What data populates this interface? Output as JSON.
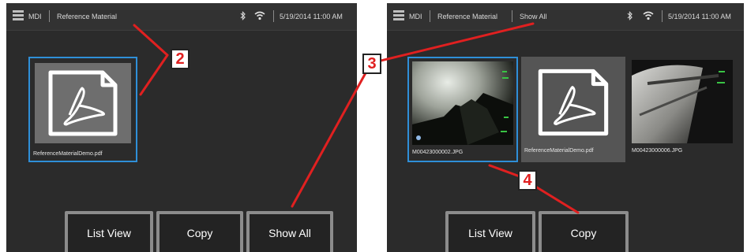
{
  "left_screen": {
    "topbar": {
      "app_label": "MDI",
      "folder_label": "Reference Material",
      "datetime": "5/19/2014 11:00 AM"
    },
    "files": [
      {
        "name": "ReferenceMaterialDemo.pdf",
        "selected": true
      }
    ],
    "buttons": {
      "list_view": "List View",
      "copy": "Copy",
      "show_all": "Show All"
    }
  },
  "right_screen": {
    "topbar": {
      "app_label": "MDI",
      "folder_label": "Reference Material",
      "view_label": "Show All",
      "datetime": "5/19/2014 11:00 AM"
    },
    "files": [
      {
        "name": "M00423000002.JPG",
        "selected": true
      },
      {
        "name": "ReferenceMaterialDemo.pdf",
        "selected": false
      },
      {
        "name": "M00423000006.JPG",
        "selected": false
      }
    ],
    "buttons": {
      "list_view": "List View",
      "copy": "Copy"
    }
  },
  "callouts": [
    "2",
    "3",
    "4"
  ],
  "colors": {
    "callout_line": "#e02020",
    "selection": "#2f8fd8",
    "screen_bg": "#2b2b2b"
  }
}
